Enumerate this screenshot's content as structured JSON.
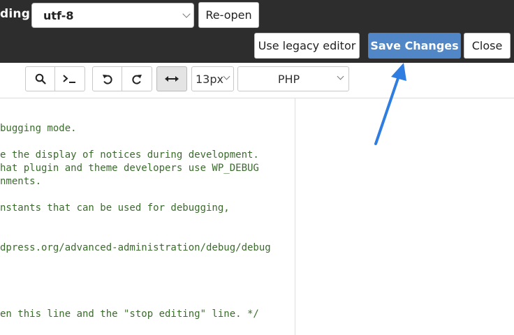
{
  "header": {
    "encoding_label": "ding:",
    "encoding_value": "utf-8",
    "reopen_label": "Re-open",
    "legacy_label": "Use legacy editor",
    "save_label": "Save Changes",
    "close_label": "Close"
  },
  "toolbar": {
    "font_size": "13px",
    "language": "PHP",
    "icons": [
      "search-icon",
      "terminal-icon",
      "undo-icon",
      "redo-icon",
      "wrap-toggle-icon"
    ]
  },
  "editor": {
    "lines": [
      "bugging mode.",
      "e the display of notices during development.",
      "hat plugin and theme developers use WP_DEBUG",
      "nments.",
      "nstants that can be used for debugging,",
      "dpress.org/advanced-administration/debug/debug",
      "en this line and the \"stop editing\" line. */"
    ]
  },
  "colors": {
    "topbar": "#2d2d2d",
    "save_button": "#5187c7",
    "code_text": "#3b6b2d",
    "annotation_arrow": "#2f7de1"
  }
}
